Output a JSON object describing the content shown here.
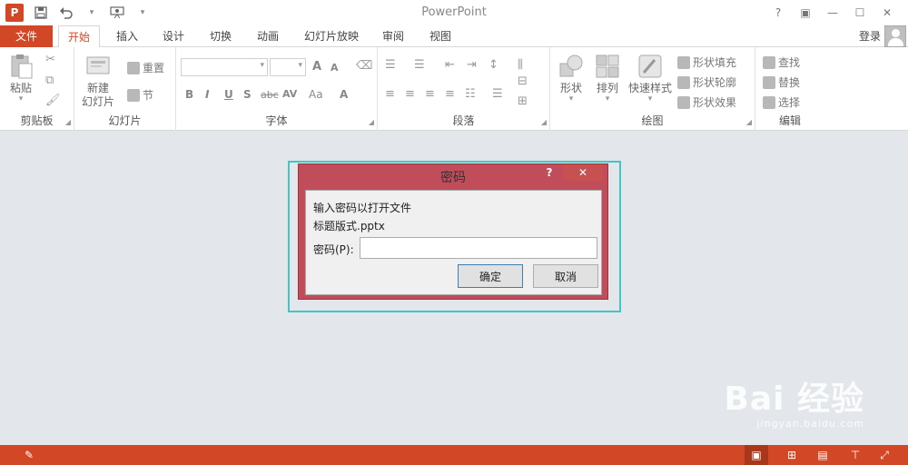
{
  "app": {
    "title": "PowerPoint",
    "logo": "P",
    "accent": "#d24726"
  },
  "qat": {
    "save_icon": "save-icon",
    "undo_icon": "undo-icon",
    "presenter_icon": "presentation-icon"
  },
  "window_controls": {
    "help": "?",
    "ribbon_options": "▣",
    "minimize": "—",
    "maximize": "☐",
    "close": "✕"
  },
  "tabs": {
    "file": "文件",
    "home": "开始",
    "insert": "插入",
    "design": "设计",
    "transitions": "切换",
    "animations": "动画",
    "slideshow": "幻灯片放映",
    "review": "审阅",
    "view": "视图"
  },
  "account": {
    "signin": "登录"
  },
  "ribbon": {
    "clipboard": {
      "label": "剪贴板",
      "paste": "粘贴"
    },
    "slides": {
      "label": "幻灯片",
      "new_slide_line1": "新建",
      "new_slide_line2": "幻灯片",
      "reset": "重置",
      "section": "节"
    },
    "font": {
      "label": "字体",
      "bold": "B",
      "italic": "I",
      "underline": "U",
      "shadow": "S",
      "strike": "abc",
      "spacing": "AV",
      "case": "Aa",
      "color": "A",
      "grow": "A",
      "shrink": "A"
    },
    "paragraph": {
      "label": "段落"
    },
    "drawing": {
      "label": "绘图",
      "shapes": "形状",
      "arrange": "排列",
      "quick_styles": "快速样式",
      "shape_fill": "形状填充",
      "shape_outline": "形状轮廓",
      "shape_effects": "形状效果"
    },
    "editing": {
      "label": "编辑",
      "find": "查找",
      "replace": "替换",
      "select": "选择"
    }
  },
  "dialog": {
    "title": "密码",
    "help": "?",
    "close": "✕",
    "message": "输入密码以打开文件",
    "filename": "标题版式.pptx",
    "password_label": "密码(P):",
    "password_value": "",
    "ok": "确定",
    "cancel": "取消",
    "titlebar_color": "#c14d5a",
    "highlight_color": "#3ec7c4"
  },
  "statusbar": {
    "color": "#d24726"
  },
  "watermark": {
    "logo": "Bai 经验",
    "url": "jingyan.baidu.com"
  }
}
